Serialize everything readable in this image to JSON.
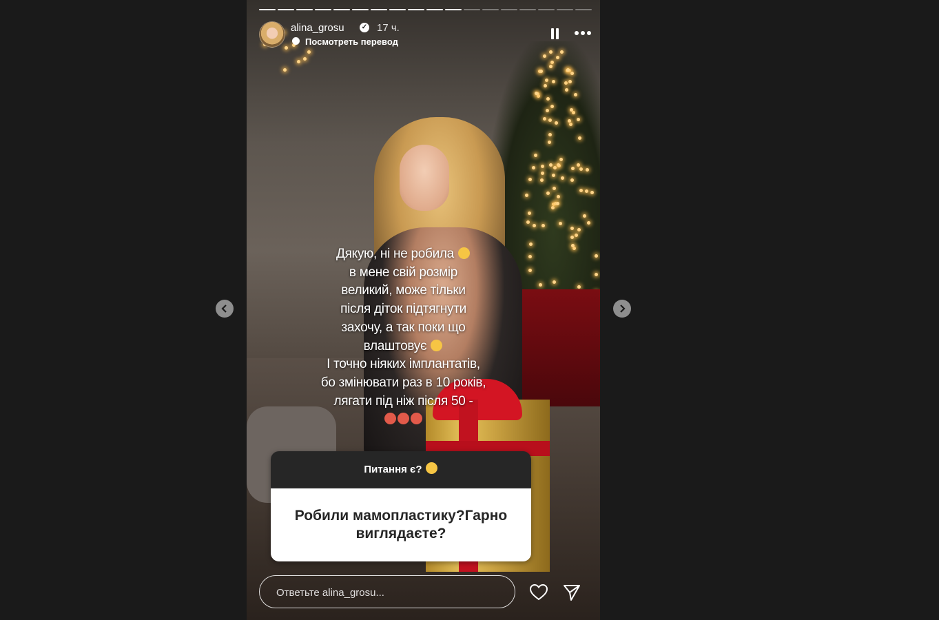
{
  "story": {
    "username": "alina_grosu",
    "time": "17 ч.",
    "translate_label": "Посмотреть перевод",
    "progress": {
      "segments": 18,
      "completed": 11
    },
    "text_lines": [
      "Дякую, ні не робила",
      "в мене свій розмір",
      "великий, може тільки",
      "після діток підтягнути",
      "захочу, а так поки що",
      "влаштовує",
      "І точно ніяких імплантатів,",
      "бо змінювати раз в 10 років,",
      "лягати під ніж після 50 -",
      ""
    ]
  },
  "question": {
    "prompt": "Питання є?",
    "answer": "Робили мамопластику?Гарно виглядаєте?"
  },
  "reply": {
    "placeholder": "Ответьте alina_grosu..."
  },
  "icons": {
    "pause": "pause-icon",
    "more": "more-icon",
    "heart": "heart-icon",
    "send": "send-icon",
    "prev": "chevron-left-icon",
    "next": "chevron-right-icon",
    "verified": "verified-icon"
  }
}
